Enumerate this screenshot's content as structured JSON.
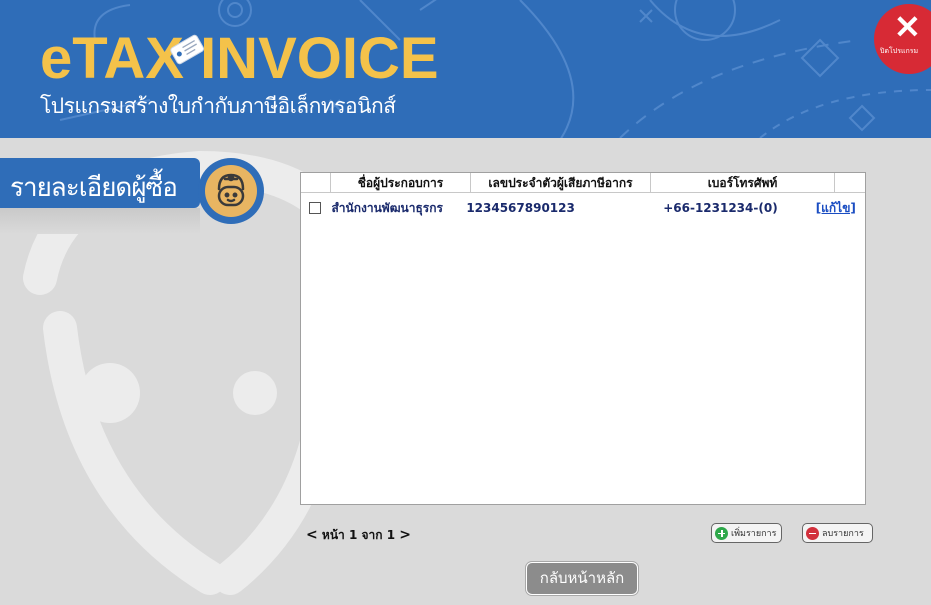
{
  "header": {
    "logo_text": "eTAX INVOICE",
    "subtitle": "โปรแกรมสร้างใบกำกับภาษีอิเล็กทรอนิกส์",
    "close_label": "ปิดโปรแกรม",
    "close_symbol": "✕"
  },
  "section": {
    "title": "รายละเอียดผู้ซื้อ"
  },
  "table": {
    "columns": [
      "",
      "ชื่อผู้ประกอบการ",
      "เลขประจำตัวผู้เสียภาษีอากร",
      "เบอร์โทรศัพท์",
      ""
    ],
    "rows": [
      {
        "name": "สำนักงานพัฒนาธุรกร",
        "tax_id": "1234567890123",
        "phone": "+66-1231234-(0)",
        "edit_label": "[แก้ไข]"
      }
    ]
  },
  "pager": {
    "prev": "<",
    "text": "หน้า 1 จาก 1",
    "next": ">"
  },
  "actions": {
    "add_label": "เพิ่มรายการ",
    "delete_label": "ลบรายการ",
    "home_label": "กลับหน้าหลัก"
  },
  "colors": {
    "header_blue": "#2f6db8",
    "logo_gold": "#f4c24a",
    "close_red": "#d72a35",
    "add_green": "#2ea84a",
    "delete_red": "#d2303c",
    "background_gray": "#dadada"
  },
  "icons": {
    "close": "close-icon",
    "avatar": "user-avatar-icon",
    "add": "plus-circle-icon",
    "delete": "minus-circle-icon"
  }
}
